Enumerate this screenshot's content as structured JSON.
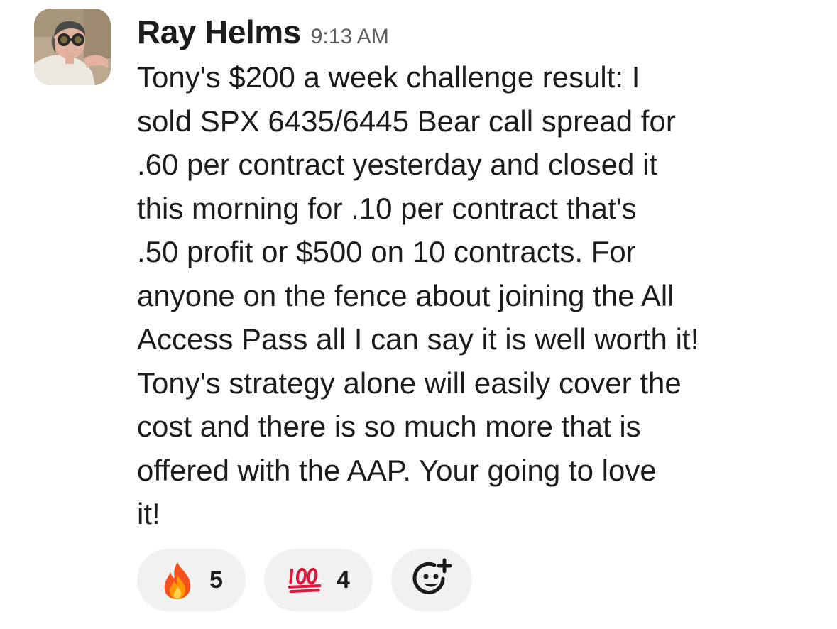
{
  "message": {
    "sender": "Ray Helms",
    "timestamp": "9:13 AM",
    "lines": [
      "Tony's $200 a week challenge result: I",
      "sold SPX 6435/6445 Bear call spread for",
      ".60 per contract yesterday and closed it",
      "this morning for .10 per contract that's",
      ".50 profit or $500 on 10 contracts. For",
      "anyone on the fence about joining the All",
      "Access Pass all I can say it is well worth it!",
      "Tony's strategy alone will easily cover the",
      "cost and there is so much more that is",
      "offered with the AAP. Your going to love",
      "it!"
    ]
  },
  "reactions": [
    {
      "emoji": "fire-emoji",
      "count": "5"
    },
    {
      "emoji": "hundred-points-emoji",
      "count": "4"
    }
  ],
  "add_reaction": {
    "icon": "add-reaction-icon"
  },
  "colors": {
    "text": "#1d1c1d",
    "timestamp": "#616061",
    "reaction_bg": "#f1f1f1",
    "hundred_red": "#e0163b"
  }
}
